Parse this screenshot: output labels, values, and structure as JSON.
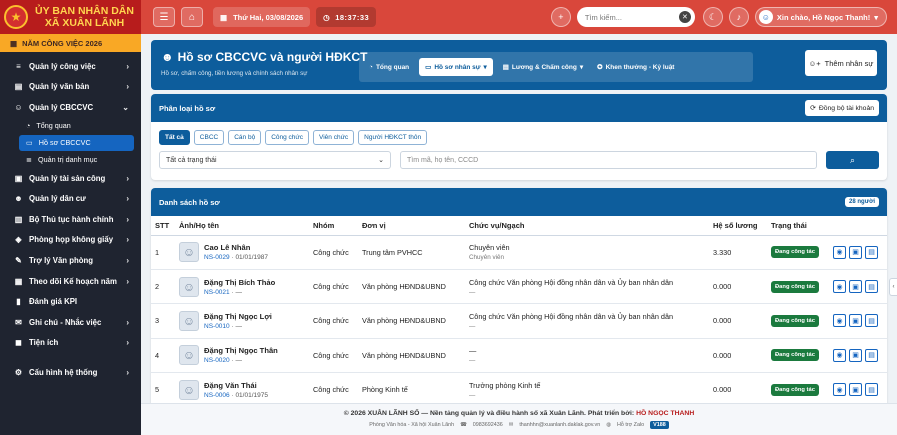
{
  "brand": {
    "line1": "ỦY BAN NHÂN DÂN",
    "line2": "XÃ XUÂN LÃNH"
  },
  "year_banner": "NĂM CÔNG VIỆC 2026",
  "sidebar": {
    "items": [
      {
        "label": "Quản lý công việc",
        "icon": "tasks-icon",
        "glyph": "≡",
        "chevron": "›"
      },
      {
        "label": "Quản lý văn bản",
        "icon": "document-icon",
        "glyph": "▤",
        "chevron": "›"
      },
      {
        "label": "Quản lý CBCCVC",
        "icon": "users-icon",
        "glyph": "☺",
        "chevron": "⌄"
      },
      {
        "label": "Quản lý tài sản công",
        "icon": "box-icon",
        "glyph": "▣",
        "chevron": "›"
      },
      {
        "label": "Quản lý dân cư",
        "icon": "people-icon",
        "glyph": "☻",
        "chevron": "›"
      },
      {
        "label": "Bộ Thủ tục hành chính",
        "icon": "book-icon",
        "glyph": "▥",
        "chevron": "›"
      },
      {
        "label": "Phòng họp không giấy",
        "icon": "meeting-icon",
        "glyph": "◈",
        "chevron": "›"
      },
      {
        "label": "Trợ lý Văn phòng",
        "icon": "assistant-icon",
        "glyph": "✎",
        "chevron": "›"
      },
      {
        "label": "Theo dõi Kế hoạch năm",
        "icon": "calendar-icon",
        "glyph": "▦",
        "chevron": "›"
      },
      {
        "label": "Đánh giá KPI",
        "icon": "chart-icon",
        "glyph": "▮",
        "chevron": ""
      },
      {
        "label": "Ghi chú - Nhắc việc",
        "icon": "note-icon",
        "glyph": "✉",
        "chevron": "›"
      },
      {
        "label": "Tiện ích",
        "icon": "apps-icon",
        "glyph": "◼",
        "chevron": "›"
      },
      {
        "label": "Cấu hình hệ thống",
        "icon": "gear-icon",
        "glyph": "⚙",
        "chevron": "›"
      }
    ],
    "subitems": [
      {
        "label": "Tổng quan",
        "icon": "chart-pie-icon",
        "glyph": "◔"
      },
      {
        "label": "Hồ sơ CBCCVC",
        "icon": "id-card-icon",
        "glyph": "▭"
      },
      {
        "label": "Quản trị danh mục",
        "icon": "list-icon",
        "glyph": "≣"
      }
    ]
  },
  "topbar": {
    "date": "Thứ Hai, 03/08/2026",
    "time": "18:37:33",
    "search_placeholder": "Tìm kiếm...",
    "user": "Xin chào, Hồ Ngọc Thanh!"
  },
  "hero": {
    "title": "Hồ sơ CBCCVC và người HĐKCT",
    "subtitle": "Hồ sơ, chấm công, tiền lương và chính sách nhân sự",
    "tabs": [
      "Tổng quan",
      "Hồ sơ nhân sự",
      "Lương & Chấm công",
      "Khen thưởng - Kỷ luật"
    ],
    "add_button": "Thêm nhân sự"
  },
  "filter_card": {
    "title": "Phân loại hồ sơ",
    "sync_button": "Đồng bộ tài khoản",
    "chips": [
      "Tất cả",
      "CBCC",
      "Cán bộ",
      "Công chức",
      "Viên chức",
      "Người HĐKCT thôn"
    ],
    "status_select": "Tất cả trạng thái",
    "search_placeholder": "Tìm mã, họ tên, CCCD"
  },
  "list_card": {
    "title": "Danh sách hồ sơ",
    "count": "28 người",
    "columns": [
      "STT",
      "Ảnh/Họ tên",
      "Nhóm",
      "Đơn vị",
      "Chức vụ/Ngạch",
      "Hệ số lương",
      "Trạng thái",
      ""
    ],
    "rows": [
      {
        "stt": "1",
        "name": "Cao Lê Nhân",
        "code": "NS-0029",
        "dob": "01/01/1987",
        "group": "Công chức",
        "unit": "Trung tâm PVHCC",
        "position": "Chuyên viên",
        "position_sub": "Chuyên viên",
        "coef": "3.330",
        "status": "Đang công tác"
      },
      {
        "stt": "2",
        "name": "Đặng Thị Bích Thảo",
        "code": "NS-0021",
        "dob": "—",
        "group": "Công chức",
        "unit": "Văn phòng HĐND&UBND",
        "position": "Công chức Văn phòng Hội đồng nhân dân và Ủy ban nhân dân",
        "position_sub": "—",
        "coef": "0.000",
        "status": "Đang công tác"
      },
      {
        "stt": "3",
        "name": "Đặng Thị Ngọc Lợi",
        "code": "NS-0010",
        "dob": "—",
        "group": "Công chức",
        "unit": "Văn phòng HĐND&UBND",
        "position": "Công chức Văn phòng Hội đồng nhân dân và Ủy ban nhân dân",
        "position_sub": "—",
        "coef": "0.000",
        "status": "Đang công tác"
      },
      {
        "stt": "4",
        "name": "Đặng Thị Ngọc Thân",
        "code": "NS-0020",
        "dob": "—",
        "group": "Công chức",
        "unit": "Văn phòng HĐND&UBND",
        "position": "—",
        "position_sub": "—",
        "coef": "0.000",
        "status": "Đang công tác"
      },
      {
        "stt": "5",
        "name": "Đặng Văn Thái",
        "code": "NS-0006",
        "dob": "01/01/1975",
        "group": "Công chức",
        "unit": "Phòng Kinh tế",
        "position": "Trưởng phòng Kinh tế",
        "position_sub": "—",
        "coef": "0.000",
        "status": "Đang công tác"
      }
    ]
  },
  "footer": {
    "line1_prefix": "© 2026 XUÂN LÃNH SỐ — Nền tảng quản lý và điều hành số xã Xuân Lãnh. Phát triển bởi:",
    "developer": "HỒ NGỌC THANH",
    "office": "Phòng Văn hóa - Xã hội Xuân Lãnh",
    "phone": "0983692436",
    "email": "thanhhn@xuanlanh.daklak.gov.vn",
    "zalo": "Hỗ trợ Zalo",
    "version": "V188"
  },
  "colors": {
    "sidebar": "#1f2430",
    "brand": "#b71c1c",
    "topbar": "#d9473b",
    "primary": "#0d5d9c",
    "active_status": "#1b7a3e",
    "year": "#f9a825"
  }
}
